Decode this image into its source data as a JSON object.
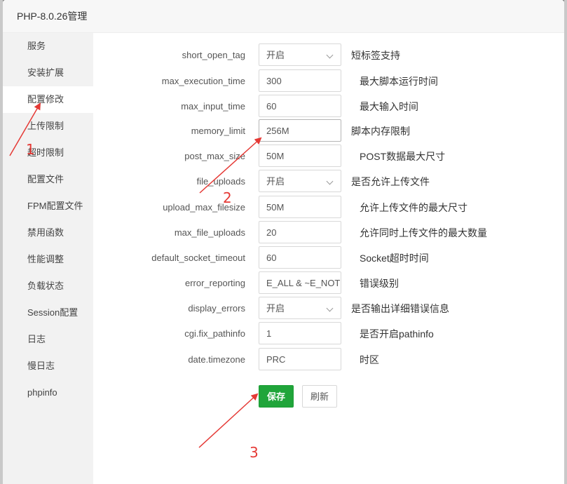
{
  "window": {
    "title": "PHP-8.0.26管理"
  },
  "sidebar": {
    "active_index": 2,
    "items": [
      {
        "label": "服务"
      },
      {
        "label": "安装扩展"
      },
      {
        "label": "配置修改"
      },
      {
        "label": "上传限制"
      },
      {
        "label": "超时限制"
      },
      {
        "label": "配置文件"
      },
      {
        "label": "FPM配置文件"
      },
      {
        "label": "禁用函数"
      },
      {
        "label": "性能调整"
      },
      {
        "label": "负载状态"
      },
      {
        "label": "Session配置"
      },
      {
        "label": "日志"
      },
      {
        "label": "慢日志"
      },
      {
        "label": "phpinfo"
      }
    ]
  },
  "settings": [
    {
      "key": "short_open_tag",
      "type": "select",
      "value": "开启",
      "desc": "短标签支持"
    },
    {
      "key": "max_execution_time",
      "type": "input",
      "value": "300",
      "desc": "最大脚本运行时间"
    },
    {
      "key": "max_input_time",
      "type": "input",
      "value": "60",
      "desc": "最大输入时间"
    },
    {
      "key": "memory_limit",
      "type": "input",
      "value": "256M",
      "desc": "脚本内存限制"
    },
    {
      "key": "post_max_size",
      "type": "input",
      "value": "50M",
      "desc": "POST数据最大尺寸"
    },
    {
      "key": "file_uploads",
      "type": "select",
      "value": "开启",
      "desc": "是否允许上传文件"
    },
    {
      "key": "upload_max_filesize",
      "type": "input",
      "value": "50M",
      "desc": "允许上传文件的最大尺寸"
    },
    {
      "key": "max_file_uploads",
      "type": "input",
      "value": "20",
      "desc": "允许同时上传文件的最大数量"
    },
    {
      "key": "default_socket_timeout",
      "type": "input",
      "value": "60",
      "desc": "Socket超时时间"
    },
    {
      "key": "error_reporting",
      "type": "input",
      "value": "E_ALL & ~E_NOT",
      "desc": "错误级别"
    },
    {
      "key": "display_errors",
      "type": "select",
      "value": "开启",
      "desc": "是否输出详细错误信息"
    },
    {
      "key": "cgi.fix_pathinfo",
      "type": "input",
      "value": "1",
      "desc": "是否开启pathinfo"
    },
    {
      "key": "date.timezone",
      "type": "input",
      "value": "PRC",
      "desc": "时区"
    }
  ],
  "buttons": {
    "save": "保存",
    "refresh": "刷新"
  },
  "annotations": {
    "n1": "1",
    "n2": "2",
    "n3": "3",
    "color": "#e53935"
  }
}
